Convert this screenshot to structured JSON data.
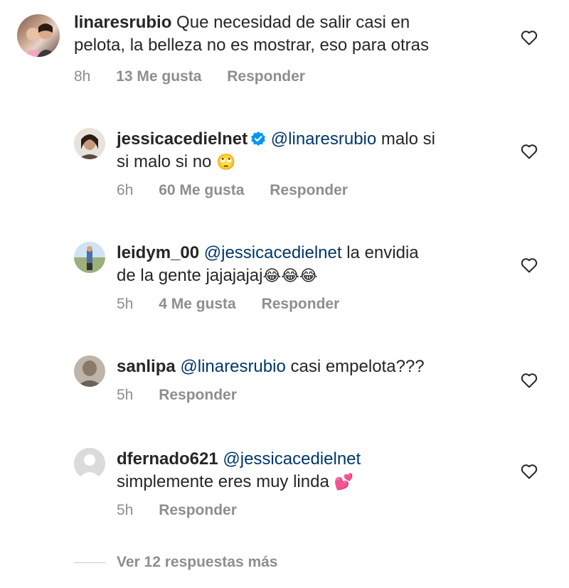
{
  "comments": [
    {
      "username": "linaresrubio",
      "mention": "",
      "text_line1": "Que necesidad de salir casi en",
      "text_line2": "pelota, la belleza no es mostrar, eso para otras",
      "time": "8h",
      "likes": "13 Me gusta",
      "reply": "Responder"
    },
    {
      "username": "jessicacedielnet",
      "mention": "@linaresrubio",
      "text_line1": "malo si",
      "text_line2": "si malo si no",
      "emoji": "🙄",
      "time": "6h",
      "likes": "60 Me gusta",
      "reply": "Responder"
    },
    {
      "username": "leidym_00",
      "mention": "@jessicacedielnet",
      "text_line1": "la envidia",
      "text_line2": "de la gente jajajajaj",
      "emoji": "😂😂😂",
      "time": "5h",
      "likes": "4 Me gusta",
      "reply": "Responder"
    },
    {
      "username": "sanlipa",
      "mention": "@linaresrubio",
      "text_line1": "casi empelota???",
      "time": "5h",
      "reply": "Responder"
    },
    {
      "username": "dfernado621",
      "mention": "@jessicacedielnet",
      "text_line2": "simplemente eres muy linda",
      "emoji": "💕",
      "time": "5h",
      "reply": "Responder"
    }
  ],
  "more_replies": "Ver 12 respuestas más",
  "colors": {
    "text": "#262626",
    "meta": "#8e8e8e",
    "mention": "#00376b",
    "verified": "#0095f6"
  }
}
